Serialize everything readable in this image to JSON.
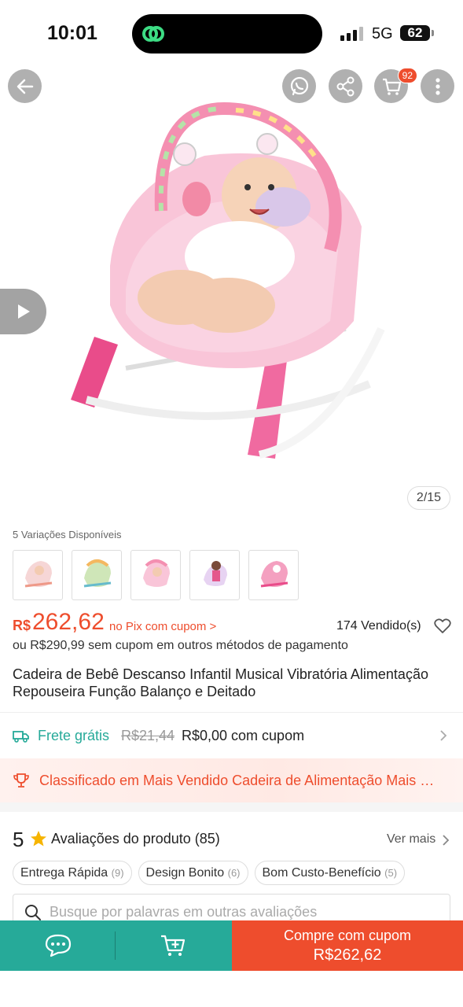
{
  "status_bar": {
    "time": "10:01",
    "network": "5G",
    "battery": "62"
  },
  "header": {
    "cart_count": "92"
  },
  "gallery": {
    "counter": "2/15"
  },
  "variations": {
    "label": "5 Variações Disponíveis",
    "count": 5
  },
  "price": {
    "currency": "R$",
    "value": "262,62",
    "pix_text": "no Pix com cupom >",
    "sold": "174 Vendido(s)",
    "alt_text": "ou R$290,99 sem cupom em outros métodos de pagamento"
  },
  "product": {
    "title": "Cadeira de Bebê Descanso Infantil Musical Vibratória Alimentação Repouseira Função Balanço e Deitado"
  },
  "shipping": {
    "free_label": "Frete grátis",
    "old_price": "R$21,44",
    "new_price": "R$0,00 com cupom"
  },
  "ranking": {
    "text": "Classificado em Mais Vendido Cadeira de Alimentação Mais Vendido"
  },
  "reviews": {
    "rating": "5",
    "title": "Avaliações do produto (85)",
    "see_more": "Ver mais",
    "chips": [
      {
        "label": "Entrega Rápida",
        "count": "(9)"
      },
      {
        "label": "Design Bonito",
        "count": "(6)"
      },
      {
        "label": "Bom Custo-Benefício",
        "count": "(5)"
      }
    ],
    "search_placeholder": "Busque por palavras em outras avaliações"
  },
  "bottom_bar": {
    "buy_label": "Compre com cupom",
    "buy_price": "R$262,62"
  },
  "colors": {
    "accent": "#ee4d2d",
    "teal": "#26aa99",
    "pink": "#f48fb1"
  }
}
